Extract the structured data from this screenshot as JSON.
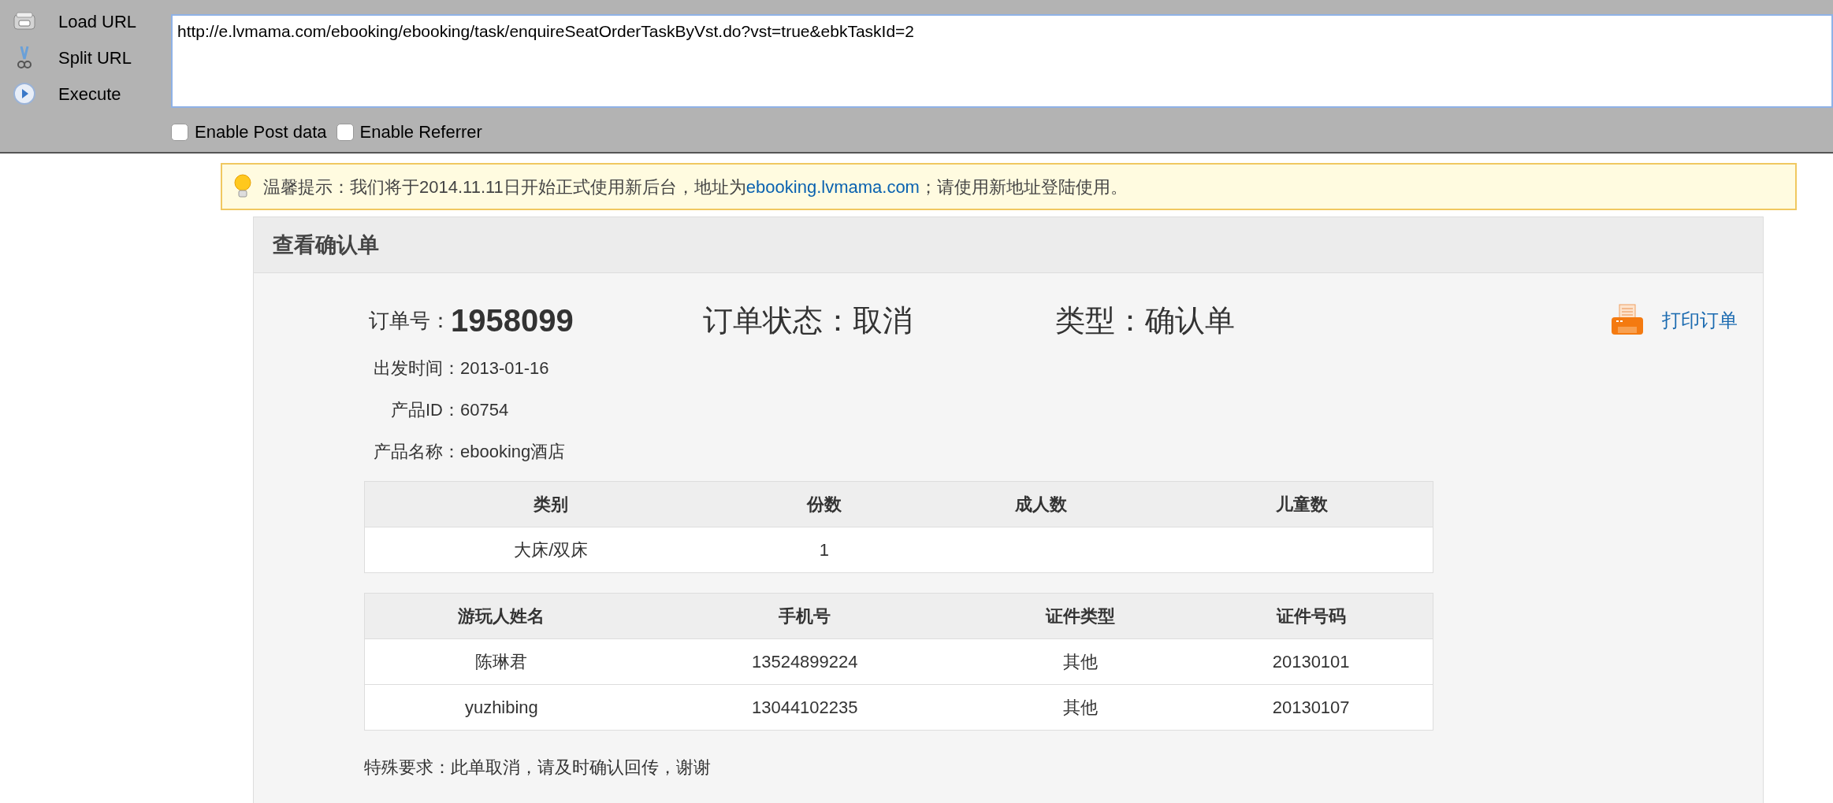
{
  "toolbar": {
    "actions": [
      {
        "kind": "load",
        "label": "Load URL"
      },
      {
        "kind": "split",
        "label": "Split URL"
      },
      {
        "kind": "execute",
        "label": "Execute"
      }
    ],
    "url": "http://e.lvmama.com/ebooking/ebooking/task/enquireSeatOrderTaskByVst.do?vst=true&ebkTaskId=2",
    "options": [
      {
        "label": "Enable Post data",
        "checked": false
      },
      {
        "label": "Enable Referrer",
        "checked": false
      }
    ]
  },
  "notice": {
    "before": "温馨提示：我们将于2014.11.11日开始正式使用新后台，地址为",
    "link": "ebooking.lvmama.com",
    "after": "；请使用新地址登陆使用。"
  },
  "panel": {
    "title": "查看确认单",
    "order": {
      "number_label": "订单号：",
      "number": "1958099",
      "status": "订单状态：取消",
      "type": "类型：确认单"
    },
    "print_link": "打印订单",
    "details": [
      {
        "label": "出发时间：",
        "value": "2013-01-16"
      },
      {
        "label": "产品ID：",
        "value": "60754"
      },
      {
        "label": "产品名称：",
        "value": "ebooking酒店"
      }
    ],
    "tables": [
      {
        "columns": [
          "类别",
          "份数",
          "成人数",
          "儿童数"
        ],
        "rows": [
          [
            "大床/双床",
            "1",
            "",
            ""
          ]
        ]
      },
      {
        "columns": [
          "游玩人姓名",
          "手机号",
          "证件类型",
          "证件号码"
        ],
        "rows": [
          [
            "陈琳君",
            "13524899224",
            "其他",
            "20130101"
          ],
          [
            "yuzhibing",
            "13044102235",
            "其他",
            "20130107"
          ]
        ]
      }
    ],
    "special_request": "特殊要求：此单取消，请及时确认回传，谢谢"
  }
}
